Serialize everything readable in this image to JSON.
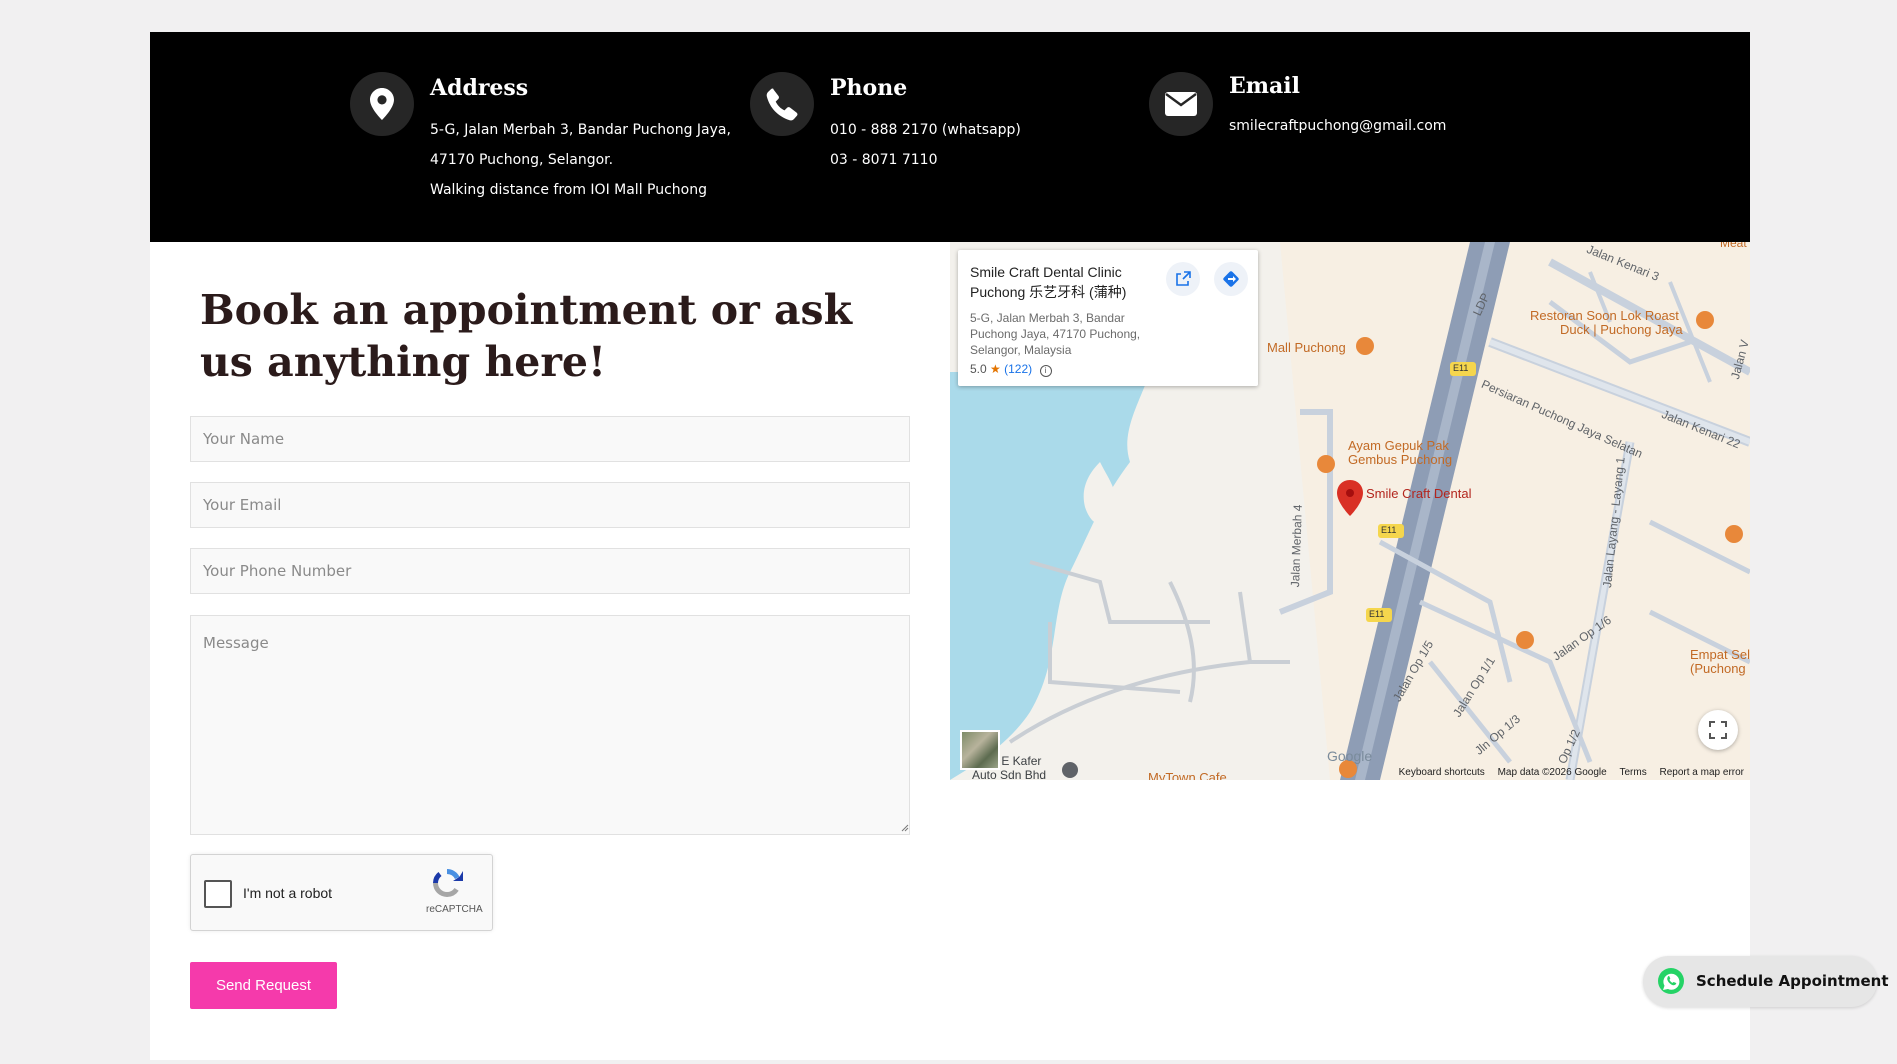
{
  "contact": {
    "address": {
      "title": "Address",
      "lines": [
        "5-G, Jalan Merbah 3, Bandar Puchong Jaya,",
        "47170 Puchong, Selangor.",
        "Walking distance from IOI Mall Puchong"
      ]
    },
    "phone": {
      "title": "Phone",
      "lines": [
        "010 - 888 2170 (whatsapp)",
        "03 - 8071 7110"
      ]
    },
    "email": {
      "title": "Email",
      "lines": [
        "smilecraftpuchong@gmail.com"
      ]
    }
  },
  "form": {
    "heading": "Book an appointment or ask us anything here!",
    "name_placeholder": "Your Name",
    "email_placeholder": "Your Email",
    "phone_placeholder": "Your Phone Number",
    "message_placeholder": "Message",
    "captcha_label": "I'm not a robot",
    "captcha_brand": "reCAPTCHA",
    "submit_label": "Send Request"
  },
  "map": {
    "card": {
      "name": "Smile Craft Dental Clinic Puchong 乐艺牙科 (蒲种)",
      "address": "5-G, Jalan Merbah 3, Bandar Puchong Jaya, 47170 Puchong, Selangor, Malaysia",
      "rating": "5.0",
      "review_count": "(122)"
    },
    "labels": {
      "mall": "Mall Puchong",
      "restoran": "Restoran Soon Lok Roast",
      "restoran2": "Duck | Puchong Jaya",
      "ayam1": "Ayam Gepuk Pak",
      "ayam2": "Gembus Puchong",
      "pin": "Smile Craft Dental",
      "persiaran": "Persiaran Puchong Jaya Selatan",
      "jalan_kenari_22": "Jalan Kenari 22",
      "jalan_kenari_3": "Jalan Kenari 3",
      "ldp": "LDP",
      "jalan_merbah_4": "Jalan Merbah 4",
      "jalan_layang_1": "Jalan Layang - Layang 1",
      "jalan_op_15": "Jalan Op 1/5",
      "jalan_op_11": "Jalan Op 1/1",
      "jalan_op_16": "Jalan Op 1/6",
      "jalan_op_13": "Jln Op 1/3",
      "jalan_op_12": "Op 1/2",
      "jalan_v": "Jalan V",
      "empat1": "Empat Sel",
      "empat2": "(Puchong",
      "kafer1": "& E Kafer",
      "kafer2": "Auto Sdn Bhd",
      "mytown": "MyTown Cafe",
      "meat": "Meat On",
      "e11": "E11",
      "google": "Google"
    },
    "footer": {
      "shortcuts": "Keyboard shortcuts",
      "mapdata": "Map data ©2026 Google",
      "terms": "Terms",
      "report": "Report a map error"
    }
  },
  "whatsapp": {
    "label": "Schedule Appointment"
  },
  "colors": {
    "accent": "#f53aab",
    "header_bg": "#000000",
    "whatsapp": "#25d366"
  }
}
